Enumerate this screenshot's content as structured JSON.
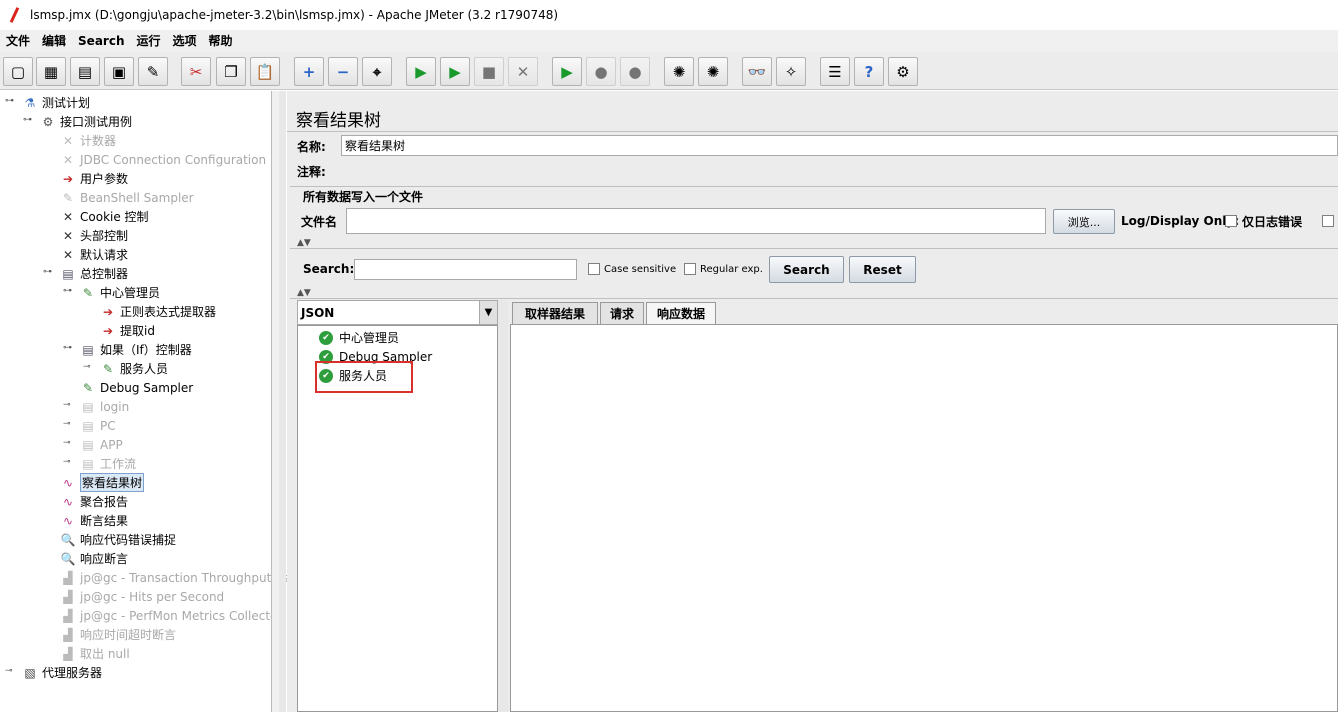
{
  "window": {
    "title": "lsmsp.jmx (D:\\gongju\\apache-jmeter-3.2\\bin\\lsmsp.jmx) - Apache JMeter (3.2 r1790748)"
  },
  "menu": [
    "文件",
    "编辑",
    "Search",
    "运行",
    "选项",
    "帮助"
  ],
  "toolbar": [
    {
      "icon": "new-icon",
      "glyph": "▢"
    },
    {
      "icon": "templates-icon",
      "glyph": "▦"
    },
    {
      "icon": "open-icon",
      "glyph": "▤"
    },
    {
      "icon": "save-icon",
      "glyph": "▣"
    },
    {
      "icon": "save-as-icon",
      "glyph": "✎"
    },
    {
      "icon": "cut-icon",
      "glyph": "✂"
    },
    {
      "icon": "copy-icon",
      "glyph": "❐"
    },
    {
      "icon": "paste-icon",
      "glyph": "📋"
    },
    {
      "icon": "expand-icon",
      "glyph": "+"
    },
    {
      "icon": "collapse-icon",
      "glyph": "−"
    },
    {
      "icon": "toggle-icon",
      "glyph": "⌖"
    },
    {
      "icon": "start-icon",
      "glyph": "▶"
    },
    {
      "icon": "start-no-pause-icon",
      "glyph": "▶"
    },
    {
      "icon": "stop-icon",
      "glyph": "■"
    },
    {
      "icon": "shutdown-icon",
      "glyph": "✕"
    },
    {
      "icon": "remote-start-icon",
      "glyph": "▶"
    },
    {
      "icon": "remote-stop-icon",
      "glyph": "●"
    },
    {
      "icon": "remote-shutdown-icon",
      "glyph": "●"
    },
    {
      "icon": "clear-icon",
      "glyph": "✺"
    },
    {
      "icon": "clear-all-icon",
      "glyph": "✺"
    },
    {
      "icon": "search-binoculars-icon",
      "glyph": "👓"
    },
    {
      "icon": "reset-search-icon",
      "glyph": "✧"
    },
    {
      "icon": "function-helper-icon",
      "glyph": "☰"
    },
    {
      "icon": "help-icon",
      "glyph": "?"
    },
    {
      "icon": "log-viewer-icon",
      "glyph": "⚙"
    }
  ],
  "tree": [
    {
      "label": "测试计划",
      "level": 0,
      "icon": "flask-icon",
      "handle": "⊶"
    },
    {
      "label": "接口测试用例",
      "level": 1,
      "icon": "gear-icon",
      "handle": "⊶"
    },
    {
      "label": "计数器",
      "level": 2,
      "icon": "tools-icon",
      "grey": true
    },
    {
      "label": "JDBC Connection Configuration",
      "level": 2,
      "icon": "tools-icon",
      "grey": true
    },
    {
      "label": "用户参数",
      "level": 2,
      "icon": "arrow-icon"
    },
    {
      "label": "BeanShell Sampler",
      "level": 2,
      "icon": "pen-icon",
      "grey": true
    },
    {
      "label": "Cookie 控制",
      "level": 2,
      "icon": "tools-icon"
    },
    {
      "label": "头部控制",
      "level": 2,
      "icon": "tools-icon"
    },
    {
      "label": "默认请求",
      "level": 2,
      "icon": "tools-icon"
    },
    {
      "label": "总控制器",
      "level": 2,
      "icon": "controller-icon",
      "handle": "⊶"
    },
    {
      "label": "中心管理员",
      "level": 3,
      "icon": "pen-icon",
      "handle": "⊶"
    },
    {
      "label": "正则表达式提取器",
      "level": 4,
      "icon": "arrow-icon"
    },
    {
      "label": "提取id",
      "level": 4,
      "icon": "arrow-icon"
    },
    {
      "label": "如果（If）控制器",
      "level": 3,
      "icon": "controller-icon",
      "handle": "⊶"
    },
    {
      "label": "服务人员",
      "level": 4,
      "icon": "pen-icon",
      "handle": "⊸"
    },
    {
      "label": "Debug Sampler",
      "level": 3,
      "icon": "pen-icon"
    },
    {
      "label": "login",
      "level": 3,
      "icon": "controller-icon",
      "grey": true,
      "handle": "⊸"
    },
    {
      "label": "PC",
      "level": 3,
      "icon": "controller-icon",
      "grey": true,
      "handle": "⊸"
    },
    {
      "label": "APP",
      "level": 3,
      "icon": "controller-icon",
      "grey": true,
      "handle": "⊸"
    },
    {
      "label": "工作流",
      "level": 3,
      "icon": "controller-icon",
      "grey": true,
      "handle": "⊸"
    },
    {
      "label": "察看结果树",
      "level": 2,
      "icon": "graph-icon",
      "selected": true
    },
    {
      "label": "聚合报告",
      "level": 2,
      "icon": "graph-icon"
    },
    {
      "label": "断言结果",
      "level": 2,
      "icon": "graph-icon"
    },
    {
      "label": "响应代码错误捕捉",
      "level": 2,
      "icon": "magnifier-icon"
    },
    {
      "label": "响应断言",
      "level": 2,
      "icon": "magnifier-icon"
    },
    {
      "label": "jp@gc - Transaction Throughput vs",
      "level": 2,
      "icon": "chart-icon",
      "grey": true
    },
    {
      "label": "jp@gc - Hits per Second",
      "level": 2,
      "icon": "chart-icon",
      "grey": true
    },
    {
      "label": "jp@gc - PerfMon Metrics Collector",
      "level": 2,
      "icon": "chart-icon",
      "grey": true
    },
    {
      "label": "响应时间超时断言",
      "level": 2,
      "icon": "chart-icon",
      "grey": true
    },
    {
      "label": "取出 null",
      "level": 2,
      "icon": "chart-icon",
      "grey": true
    },
    {
      "label": "代理服务器",
      "level": 0,
      "icon": "workbench-icon",
      "handle": "⊸"
    }
  ],
  "panel": {
    "title": "察看结果树",
    "name_label": "名称:",
    "name_value": "察看结果树",
    "comment_label": "注释:",
    "comment_value": "",
    "file_group": "所有数据写入一个文件",
    "file_label": "文件名",
    "file_value": "",
    "browse": "浏览...",
    "log_display": "Log/Display Only:",
    "errors_only": "仅日志错误"
  },
  "search": {
    "label": "Search:",
    "value": "",
    "case_sensitive": "Case sensitive",
    "regex": "Regular exp.",
    "search_btn": "Search",
    "reset_btn": "Reset"
  },
  "results": {
    "renderer": "JSON",
    "items": [
      "中心管理员",
      "Debug Sampler",
      "服务人员"
    ],
    "tabs": [
      "取样器结果",
      "请求",
      "响应数据"
    ],
    "active_tab": 2
  }
}
